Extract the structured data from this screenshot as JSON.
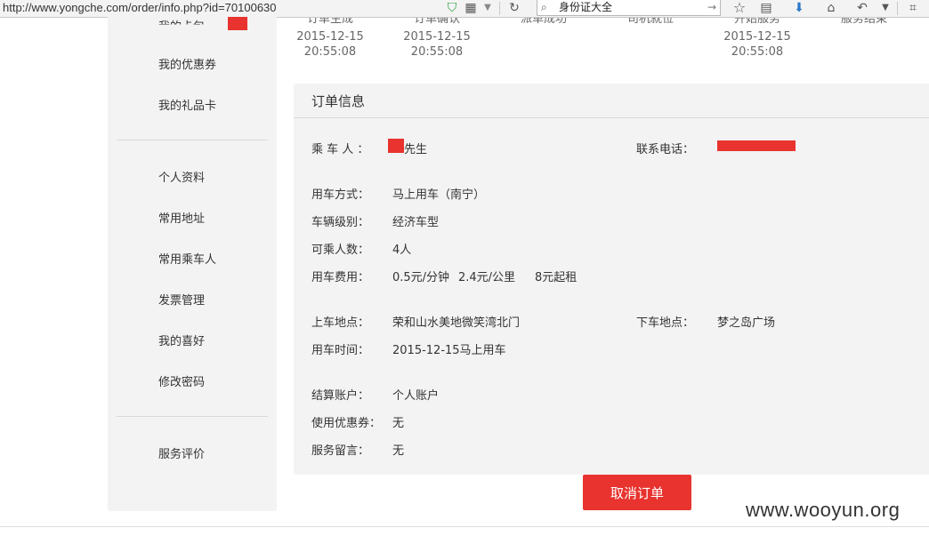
{
  "browser": {
    "url": "http://www.yongche.com/order/info.php?id=70100630",
    "search_value": "身份证大全",
    "icons": [
      "shield-icon",
      "qr-icon",
      "dropdown-icon",
      "reload-icon",
      "search-icon",
      "go-arrow-icon",
      "star-icon",
      "reading-list-icon",
      "download-icon",
      "home-icon",
      "back-icon",
      "menu-dropdown-icon",
      "crop-icon"
    ]
  },
  "sidebar": {
    "top_cut_label": "我的卡包",
    "group1": [
      "我的优惠券",
      "我的礼品卡"
    ],
    "group2": [
      "个人资料",
      "常用地址",
      "常用乘车人",
      "发票管理",
      "我的喜好",
      "修改密码"
    ],
    "group3": [
      "服务评价"
    ]
  },
  "steps": [
    {
      "label": "订单生成",
      "date": "2015-12-15",
      "time": "20:55:08"
    },
    {
      "label": "订单确认",
      "date": "2015-12-15",
      "time": "20:55:08"
    },
    {
      "label": "派单成功",
      "date": "",
      "time": ""
    },
    {
      "label": "司机就位",
      "date": "",
      "time": ""
    },
    {
      "label": "开始服务",
      "date": "2015-12-15",
      "time": "20:55:08"
    },
    {
      "label": "服务结束",
      "date": "",
      "time": ""
    }
  ],
  "order": {
    "title": "订单信息",
    "passenger_label": "乘 车 人 ：",
    "passenger_value": "先生",
    "phone_label": "联系电话：",
    "mode_label": "用车方式：",
    "mode_value": "马上用车（南宁）",
    "level_label": "车辆级别：",
    "level_value": "经济车型",
    "seats_label": "可乘人数：",
    "seats_value": "4人",
    "fee_label": "用车费用：",
    "fee_min": "0.5元/分钟",
    "fee_km": "2.4元/公里",
    "fee_start": "8元起租",
    "pickup_label": "上车地点：",
    "pickup_value": "荣和山水美地微笑湾北门",
    "dropoff_label": "下车地点：",
    "dropoff_value": "梦之岛广场",
    "time_label": "用车时间：",
    "time_value": "2015-12-15马上用车",
    "account_label": "结算账户：",
    "account_value": "个人账户",
    "coupon_label": "使用优惠券：",
    "coupon_value": "无",
    "message_label": "服务留言：",
    "message_value": "无"
  },
  "cancel_label": "取消订单",
  "watermark": "www.wooyun.org",
  "colors": {
    "accent_red": "#e8332e",
    "panel_bg": "#f3f3f3"
  }
}
